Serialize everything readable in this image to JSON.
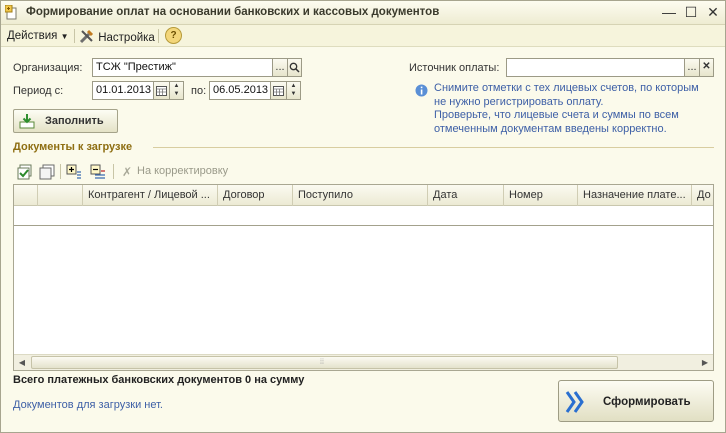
{
  "window": {
    "title": "Формирование оплат на основании банковских и кассовых документов",
    "minimize": "—",
    "maximize": "☐",
    "close": "✕"
  },
  "toolbar": {
    "actions": "Действия",
    "settings": "Настройка",
    "help": "?"
  },
  "form": {
    "org_label": "Организация:",
    "org_value": "ТСЖ \"Престиж\"",
    "period_label": "Период с:",
    "date_from": "01.01.2013",
    "to_label": "по:",
    "date_to": "06.05.2013",
    "source_label": "Источник оплаты:",
    "source_value": "",
    "select_btn": "...",
    "clear_btn": "✕",
    "fill_button": "Заполнить"
  },
  "info": {
    "line1": "Снимите отметки с тех лицевых счетов, по которым",
    "line2": "не нужно регистрировать оплату.",
    "line3": "Проверьте, что лицевые счета и суммы по всем",
    "line4": "отмеченным документам введены корректно."
  },
  "section": {
    "title": "Документы к загрузке",
    "correct_link": "На корректировку"
  },
  "grid": {
    "columns": [
      "",
      "Контрагент / Лицевой ...",
      "Договор",
      "Поступило",
      "Дата",
      "Номер",
      "Назначение плате...",
      "До"
    ],
    "rows": []
  },
  "footer": {
    "total": "Всего платежных банковских документов 0 на сумму",
    "no_docs": "Документов для загрузки нет.",
    "form_button": "Сформировать"
  },
  "colors": {
    "window_bg": "#fbfaeb",
    "accent_gold": "#8e6e12",
    "info_blue": "#3d5fa6"
  }
}
